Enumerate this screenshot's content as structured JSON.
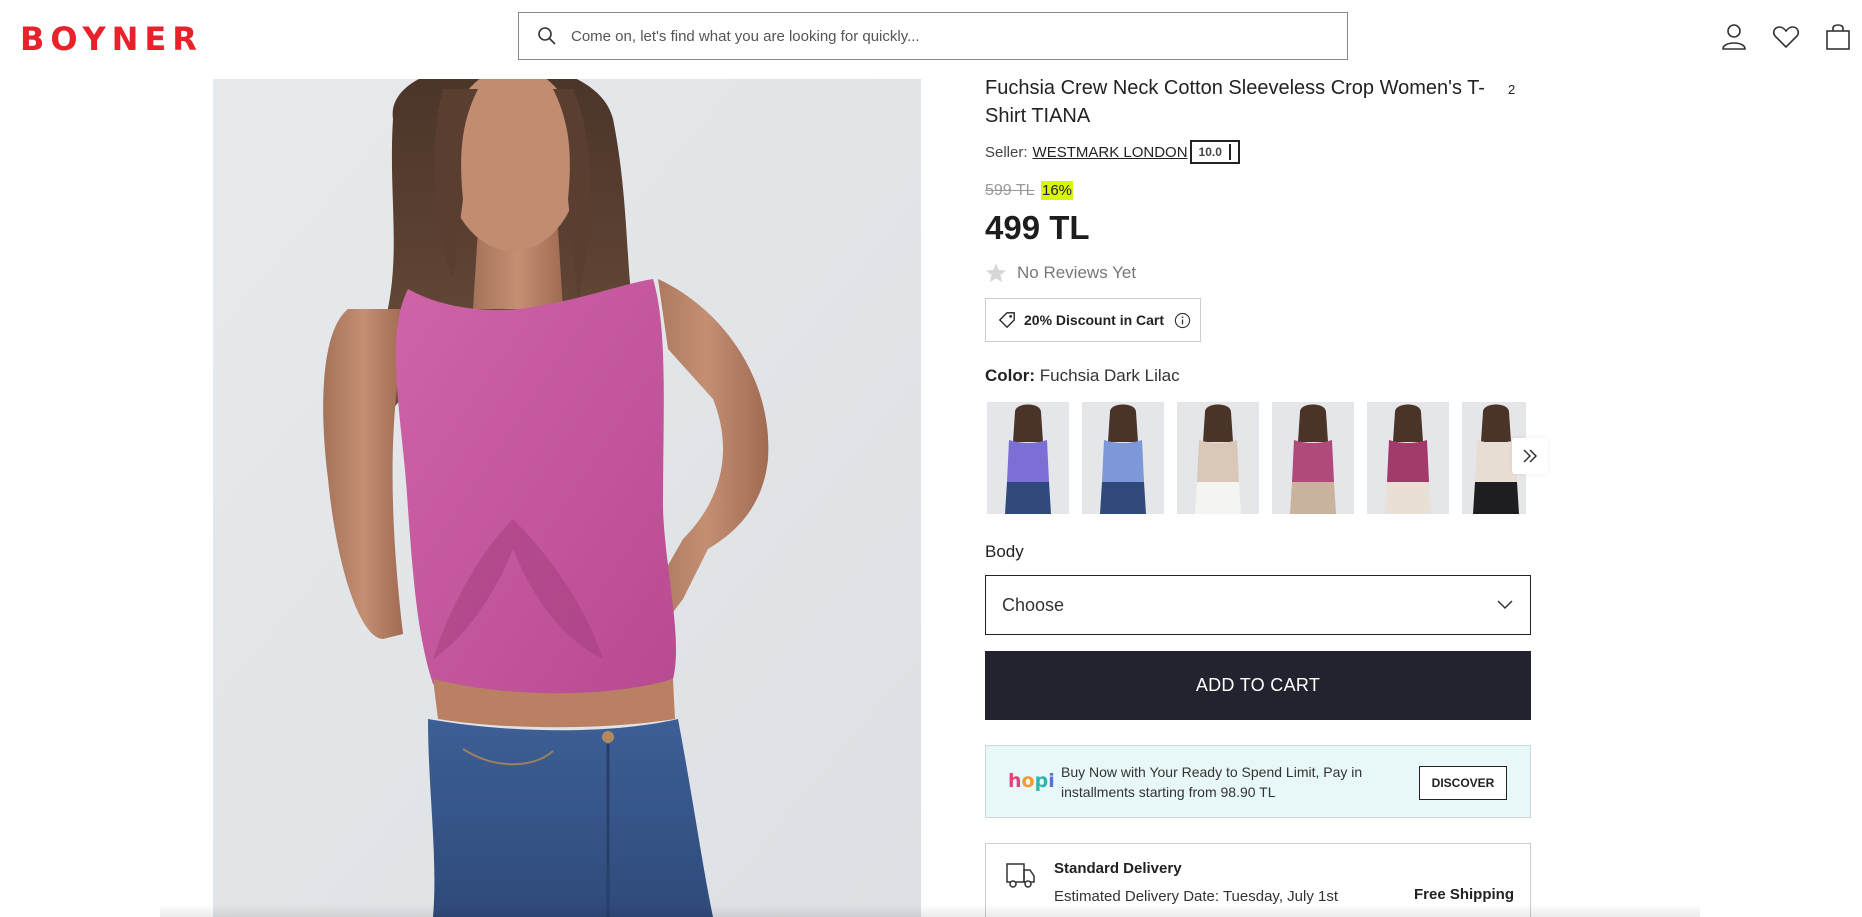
{
  "header": {
    "logo": "BOYNER",
    "search_placeholder": "Come on, let's find what you are looking for quickly...",
    "icons": [
      "user-icon",
      "heart-icon",
      "shopping-bag-icon"
    ]
  },
  "product": {
    "title": "Fuchsia Crew Neck Cotton Sleeveless Crop Women's T-Shirt TIANA",
    "image_count": "2",
    "seller_label": "Seller:",
    "seller_name": "WESTMARK LONDON",
    "seller_score": "10.0",
    "old_price": "599 TL",
    "discount": "16%",
    "price": "499 TL",
    "reviews": "No Reviews Yet",
    "cart_discount": "20% Discount in Cart",
    "color_label": "Color:",
    "color_value": "Fuchsia Dark Lilac",
    "swatch_colors": [
      "#7b6fd6",
      "#7e97d8",
      "#d9c7b8",
      "#b04a7a",
      "#a23a6a",
      "#e8ddd3"
    ],
    "body_label": "Body",
    "size_placeholder": "Choose",
    "add_to_cart": "ADD TO CART"
  },
  "hopi": {
    "logo": "hopi",
    "text": "Buy Now with Your Ready to Spend Limit, Pay in installments starting from 98.90 TL",
    "button": "DISCOVER"
  },
  "delivery": {
    "title": "Standard Delivery",
    "date": "Estimated Delivery Date: Tuesday, July 1st",
    "shipping": "Free Shipping"
  },
  "colors": {
    "brand": "#e8222b",
    "cta": "#23232f",
    "discount_badge": "#d9f50c",
    "hopi_bg": "#e8f7f7",
    "shirt": "#c9559f"
  }
}
